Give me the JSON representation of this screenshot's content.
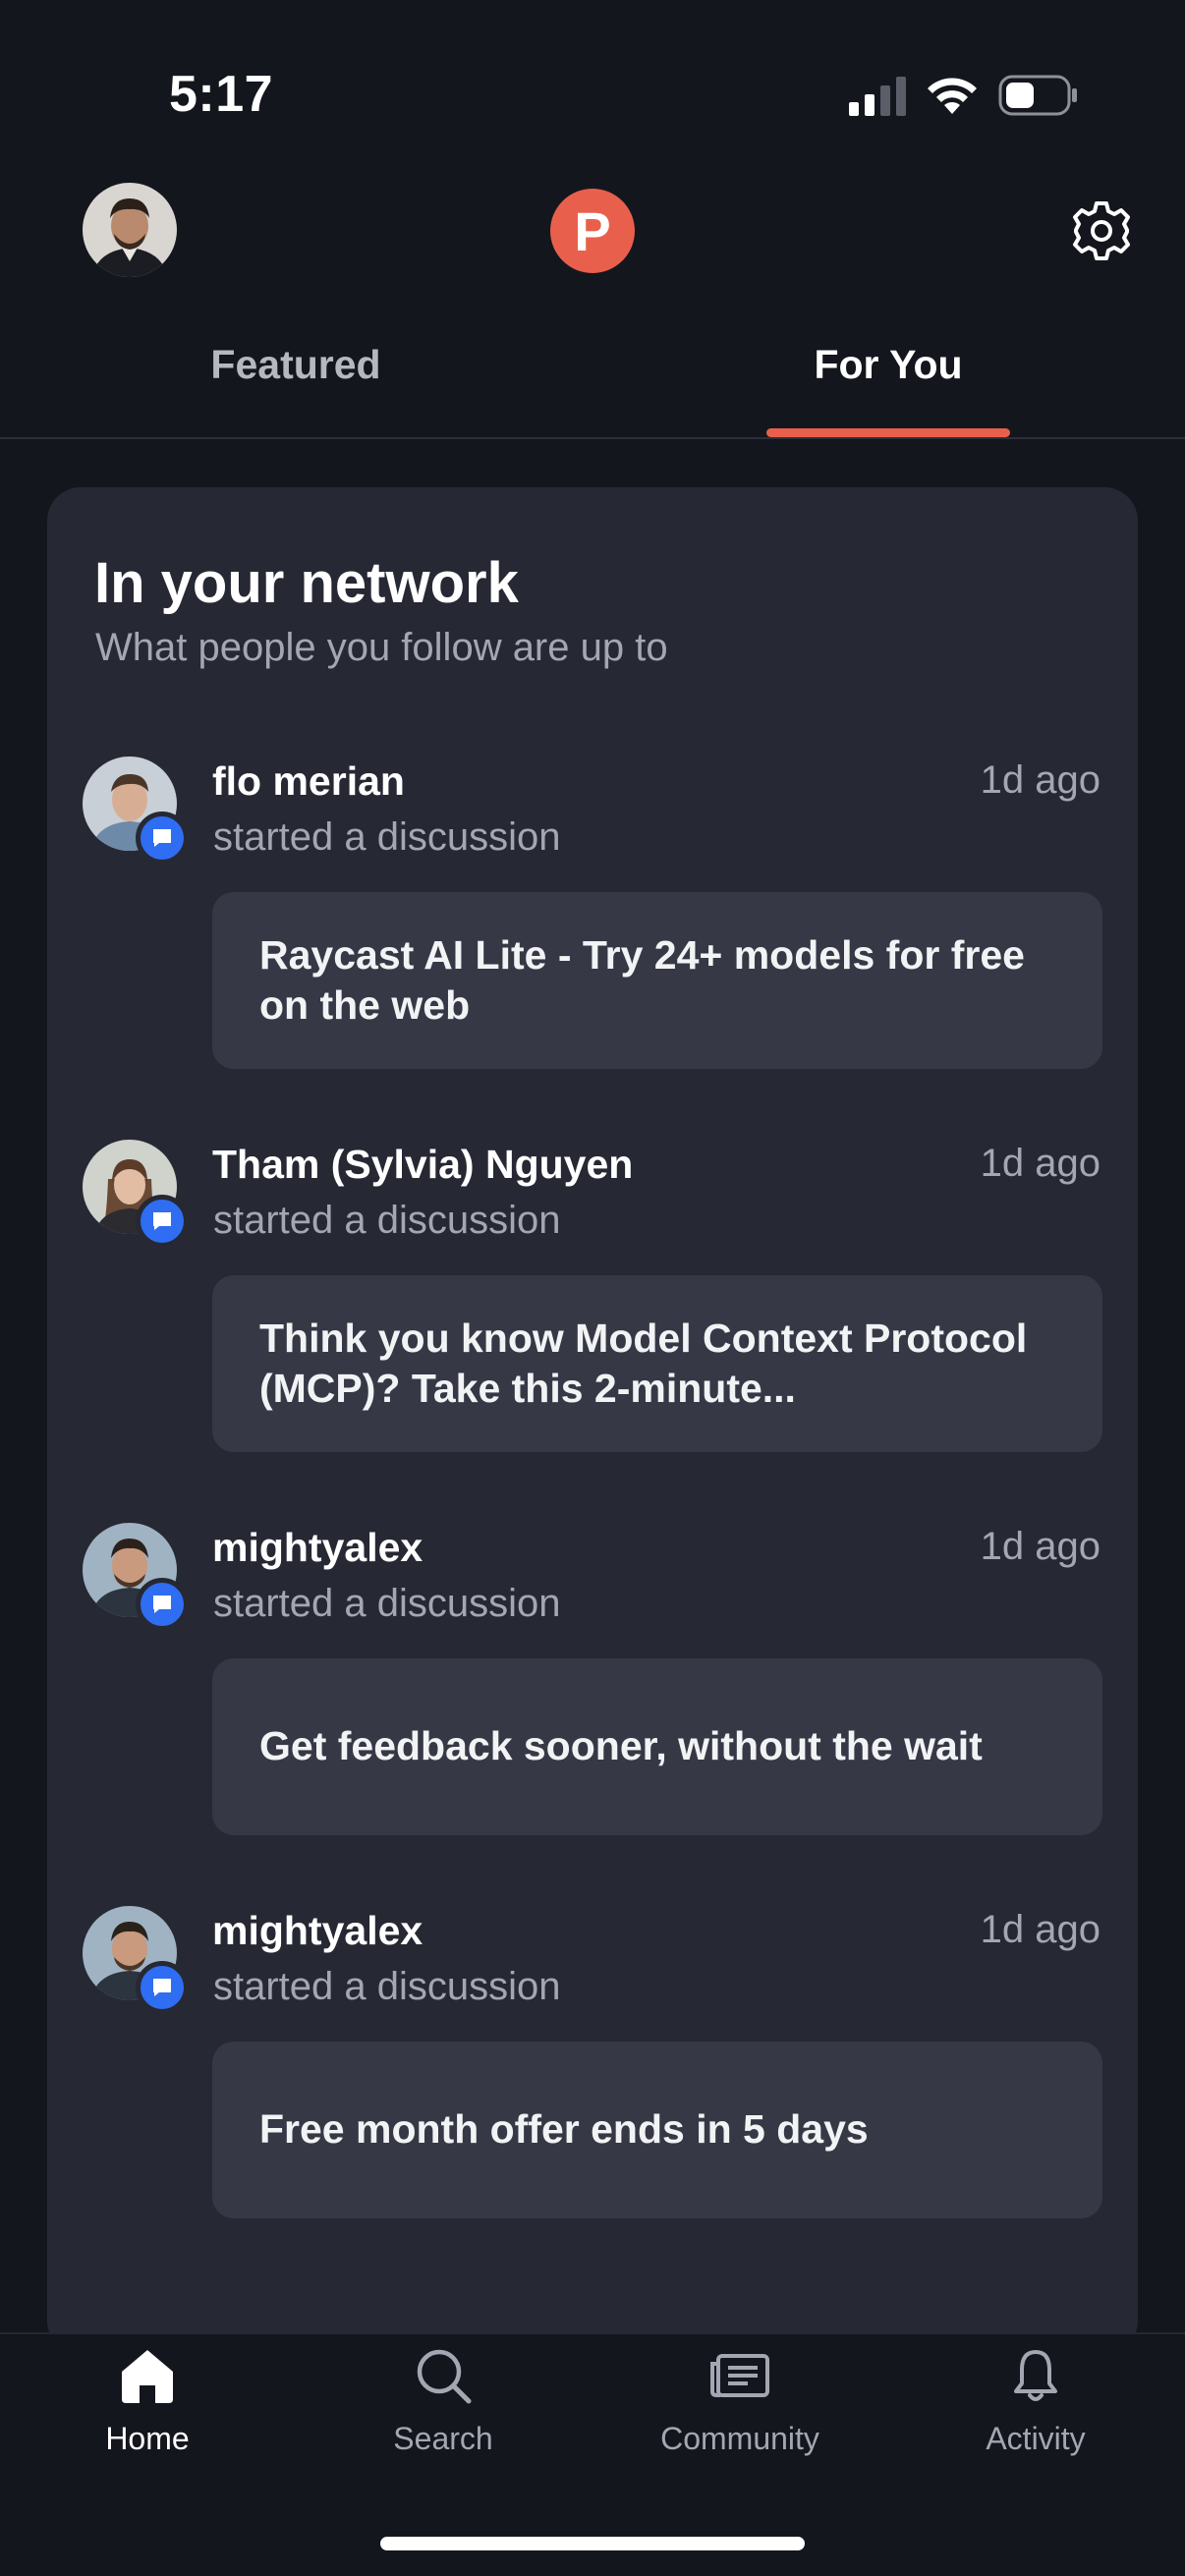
{
  "status_bar": {
    "time": "5:17"
  },
  "header": {
    "logo_letter": "P"
  },
  "tabs": [
    {
      "label": "Featured"
    },
    {
      "label": "For You"
    }
  ],
  "network": {
    "title": "In your network",
    "subtitle": "What people you follow are up to"
  },
  "feed": [
    {
      "name": "flo merian",
      "time": "1d ago",
      "action": "started a discussion",
      "card": "Raycast AI Lite - Try 24+ models for free on the web"
    },
    {
      "name": "Tham (Sylvia) Nguyen",
      "time": "1d ago",
      "action": "started a discussion",
      "card": "Think you know Model Context Protocol (MCP)? Take this 2-minute..."
    },
    {
      "name": "mightyalex",
      "time": "1d ago",
      "action": "started a discussion",
      "card": "Get feedback sooner, without the wait"
    },
    {
      "name": "mightyalex",
      "time": "1d ago",
      "action": "started a discussion",
      "card": "Free month offer ends in 5 days"
    }
  ],
  "bottom_nav": [
    {
      "label": "Home",
      "icon": "home-icon"
    },
    {
      "label": "Search",
      "icon": "search-icon"
    },
    {
      "label": "Community",
      "icon": "community-icon"
    },
    {
      "label": "Activity",
      "icon": "bell-icon"
    }
  ],
  "colors": {
    "accent": "#e8604c",
    "badge": "#2f6df3",
    "background": "#14161d",
    "panel": "#262833",
    "card": "#363945"
  }
}
